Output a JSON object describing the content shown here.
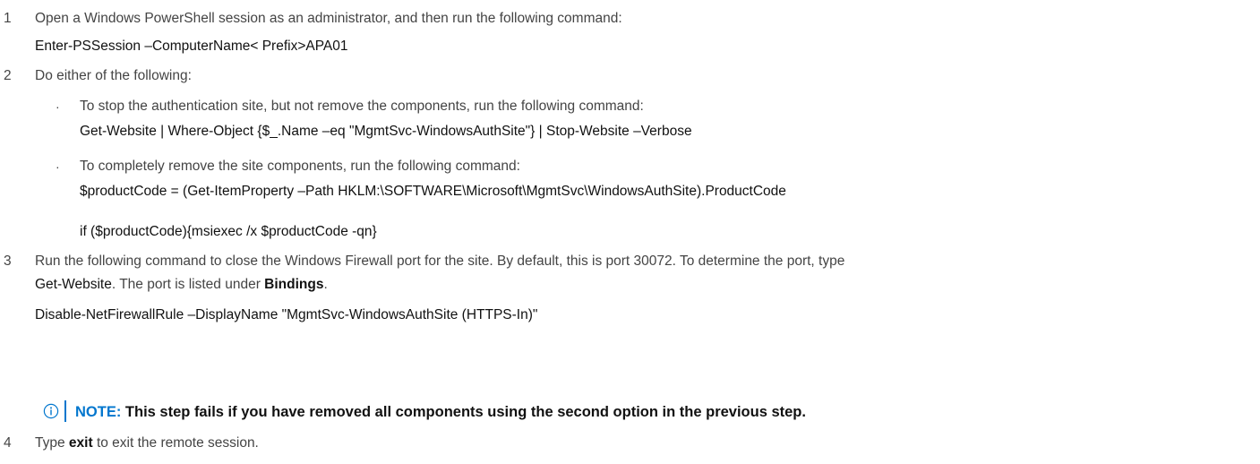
{
  "steps": [
    {
      "number": "1",
      "text": "Open a Windows PowerShell session as an administrator, and then run the following command:",
      "command": "Enter-PSSession –ComputerName< Prefix>APA01"
    },
    {
      "number": "2",
      "text": "Do either of the following:",
      "bullets": [
        {
          "text": "To stop the authentication site, but not remove the components, run the following command:",
          "command": "Get-Website | Where-Object {$_.Name –eq \"MgmtSvc-WindowsAuthSite\"} | Stop-Website –Verbose"
        },
        {
          "text": "To completely remove the site components, run the following command:",
          "command": "$productCode = (Get-ItemProperty –Path HKLM:\\SOFTWARE\\Microsoft\\MgmtSvc\\WindowsAuthSite).ProductCode",
          "command2": "if ($productCode){msiexec /x $productCode -qn}"
        }
      ]
    },
    {
      "number": "3",
      "text_line1": "Run the following command to close the Windows Firewall port for the site. By default, this is port 30072. To determine the port, type",
      "inline_command": "Get-Website",
      "text_line2_mid": ". The port is listed under ",
      "bold_term": "Bindings",
      "text_line2_end": ".",
      "command": "Disable-NetFirewallRule –DisplayName \"MgmtSvc-WindowsAuthSite (HTTPS-In)\""
    },
    {
      "number": "4",
      "text_pre": "Type ",
      "bold_term": "exit",
      "text_post": " to exit the remote session."
    }
  ],
  "note": {
    "label": "NOTE:",
    "text": " This step fails if you have removed all components using the second option in the previous step.",
    "icon": "info-icon",
    "accent_color": "#0076ce"
  }
}
